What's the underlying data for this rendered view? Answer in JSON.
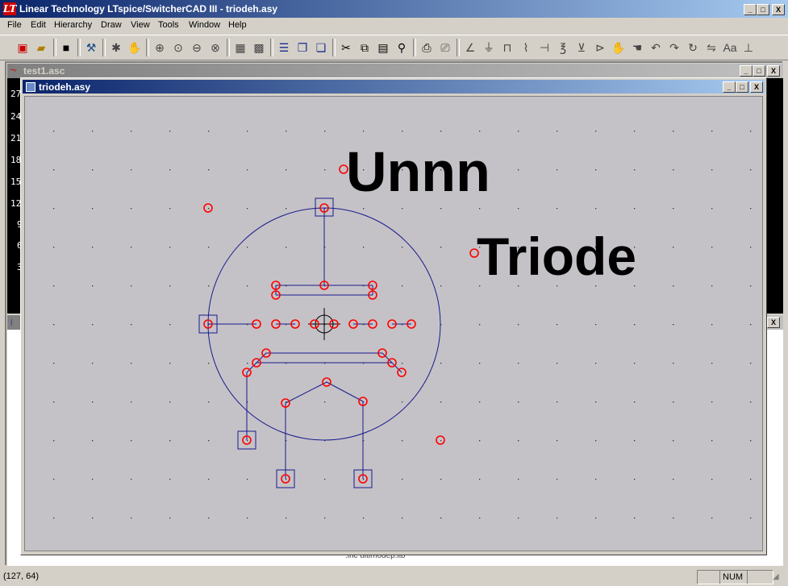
{
  "window": {
    "title": "Linear Technology LTspice/SwitcherCAD III - triodeh.asy",
    "minimize": "_",
    "maximize": "□",
    "close": "X"
  },
  "menu": [
    "File",
    "Edit",
    "Hierarchy",
    "Draw",
    "View",
    "Tools",
    "Window",
    "Help"
  ],
  "toolbar_icons": [
    "new-schematic-icon",
    "open-icon",
    "save-icon",
    "hammer-icon",
    "run-icon",
    "pan-hand-icon",
    "zoom-in-icon",
    "zoom-area-icon",
    "zoom-out-icon",
    "zoom-fit-icon",
    "autorange-icon",
    "grid-icon",
    "tile-horizontal-icon",
    "cascade-icon",
    "tile-vertical-icon",
    "cut-icon",
    "copy-icon",
    "paste-icon",
    "find-icon",
    "print-icon",
    "print-preview-icon",
    "wire-icon",
    "ground-icon",
    "label-icon",
    "resistor-icon",
    "capacitor-icon",
    "inductor-icon",
    "diode-icon",
    "component-icon",
    "move-icon",
    "drag-icon",
    "undo-icon",
    "redo-icon",
    "rotate-icon",
    "mirror-icon",
    "text-icon",
    "spice-directive-icon"
  ],
  "back_window": {
    "title": "test1.asc",
    "axis_labels": [
      "27",
      "24",
      "21",
      "18",
      "15",
      "12",
      "9",
      "6",
      "3"
    ]
  },
  "front_window": {
    "title": "triodeh.asy"
  },
  "symbol": {
    "label_big": "Unnn",
    "label_name": "Triode"
  },
  "netlist_hint": ".inc ultimodep.lib",
  "status": {
    "coords": "(127, 64)",
    "num": "NUM"
  },
  "colors": {
    "titlebar_active": "#0a246a",
    "pin_circle": "#ff0000",
    "symbol_line": "#1a1a8c",
    "canvas_bg": "#c4c2c7"
  }
}
